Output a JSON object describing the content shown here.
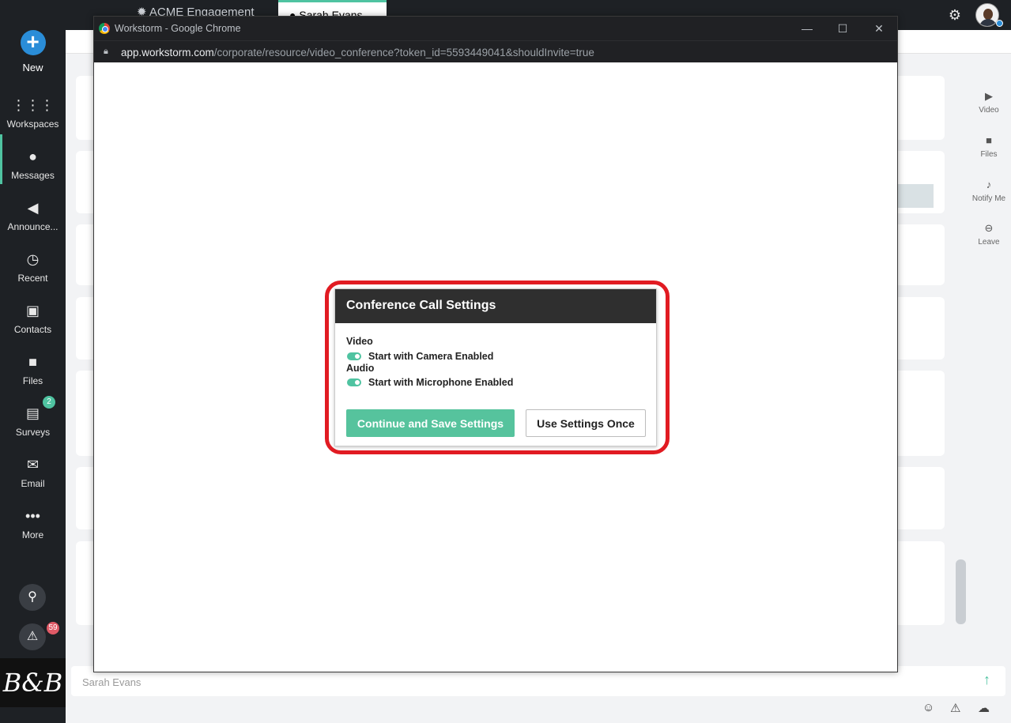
{
  "sidebar": {
    "new_label": "New",
    "items": [
      {
        "label": "Workspaces",
        "icon": "grid-icon"
      },
      {
        "label": "Messages",
        "icon": "chat-icon"
      },
      {
        "label": "Announce...",
        "icon": "megaphone-icon"
      },
      {
        "label": "Recent",
        "icon": "history-icon"
      },
      {
        "label": "Contacts",
        "icon": "contacts-icon"
      },
      {
        "label": "Files",
        "icon": "folder-icon"
      },
      {
        "label": "Surveys",
        "icon": "clipboard-icon"
      },
      {
        "label": "Email",
        "icon": "envelope-icon"
      },
      {
        "label": "More",
        "icon": "ellipsis-icon"
      }
    ],
    "surveys_badge": "2",
    "alerts_badge": "59",
    "logo_text": "B&B"
  },
  "topbar": {
    "tab1": "ACME Engagement",
    "tab2": "Sarah Evans"
  },
  "right_panel": {
    "video": "Video",
    "files": "Files",
    "notify": "Notify Me",
    "leave": "Leave"
  },
  "composer": {
    "placeholder": "Sarah Evans"
  },
  "chrome": {
    "window_title": "Workstorm - Google Chrome",
    "url_host": "app.workstorm.com",
    "url_path": "/corporate/resource/video_conference?token_id=5593449041&shouldInvite=true"
  },
  "dialog": {
    "title": "Conference Call Settings",
    "video_heading": "Video",
    "video_option": "Start with Camera Enabled",
    "video_enabled": true,
    "audio_heading": "Audio",
    "audio_option": "Start with Microphone Enabled",
    "audio_enabled": true,
    "primary_button": "Continue and Save Settings",
    "secondary_button": "Use Settings Once"
  },
  "colors": {
    "accent": "#4fc3a1",
    "primary_button": "#56c39d",
    "highlight": "#e11b22",
    "sidebar_bg": "#1e2125"
  }
}
